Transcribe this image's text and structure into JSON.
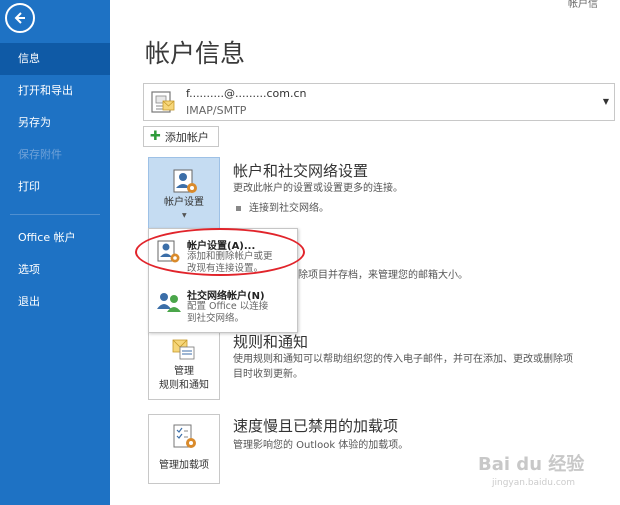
{
  "sidebar": {
    "items": [
      {
        "label": "信息"
      },
      {
        "label": "打开和导出"
      },
      {
        "label": "另存为"
      },
      {
        "label": "保存附件"
      },
      {
        "label": "打印"
      },
      {
        "label": "Office 帐户"
      },
      {
        "label": "选项"
      },
      {
        "label": "退出"
      }
    ]
  },
  "top_right": "帐户信",
  "page_title": "帐户信息",
  "account": {
    "email": "f..........@.........com.cn",
    "type": "IMAP/SMTP"
  },
  "add_account_label": "添加帐户",
  "account_settings": {
    "tile_label": "帐户设置",
    "title": "帐户和社交网络设置",
    "desc": "更改此帐户的设置或设置更多的连接。",
    "bullet": "连接到社交网络。"
  },
  "menu": {
    "item1_title": "帐户设置(A)...",
    "item1_desc1": "添加和删除帐户或更",
    "item1_desc2": "改现有连接设置。",
    "item2_title": "社交网络帐户(N)",
    "item2_desc1": "配置 Office 以连接",
    "item2_desc2": "到社交网络。"
  },
  "cleanup_desc": "除项目并存档，来管理您的邮箱大小。",
  "rules": {
    "tile_line1": "管理",
    "tile_line2": "规则和通知",
    "title": "规则和通知",
    "desc1": "使用规则和通知可以帮助组织您的传入电子邮件，并可在添加、更改或删除项",
    "desc2": "目时收到更新。"
  },
  "addins": {
    "tile_label": "管理加载项",
    "title": "速度慢且已禁用的加载项",
    "desc": "管理影响您的 Outlook 体验的加载项。"
  },
  "watermark": "Bai du 经验",
  "watermark_sub": "jingyan.baidu.com",
  "colors": {
    "sidebar": "#1e72c4",
    "sidebar_active": "#0f5aa6",
    "highlight_ellipse": "#e1242b"
  }
}
